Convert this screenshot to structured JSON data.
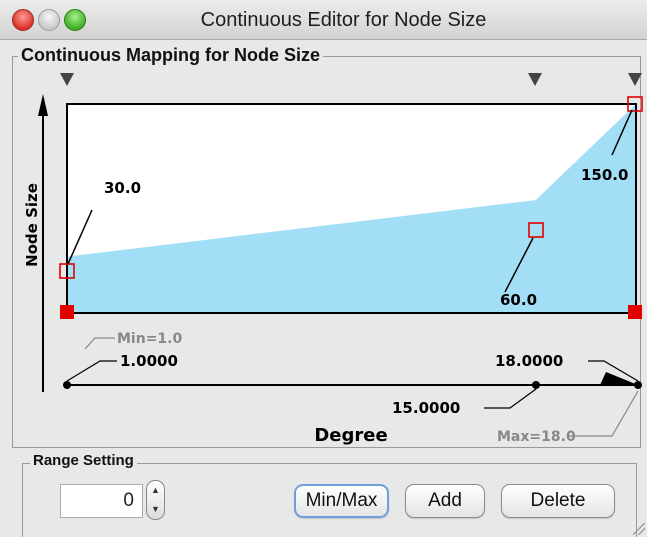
{
  "window": {
    "title": "Continuous Editor for Node Size"
  },
  "mapping_group": {
    "title": "Continuous Mapping for Node Size"
  },
  "graph": {
    "y_axis_label": "Node Size",
    "x_axis_label": "Degree",
    "points": [
      {
        "degree": 1.0,
        "value": 30.0,
        "label": "30.0"
      },
      {
        "degree": 15.0,
        "value": 60.0,
        "label": "60.0"
      },
      {
        "degree": 18.0,
        "value": 150.0,
        "label": "150.0"
      }
    ],
    "fill_color": "#a2dff6",
    "handle_color": "#e00000"
  },
  "slider": {
    "min_label": "Min=1.0",
    "max_label": "Max=18.0",
    "thumbs": [
      "1.0000",
      "15.0000",
      "18.0000"
    ]
  },
  "range_setting": {
    "title": "Range Setting",
    "value": "0",
    "buttons": {
      "minmax": "Min/Max",
      "add": "Add",
      "delete": "Delete"
    }
  }
}
